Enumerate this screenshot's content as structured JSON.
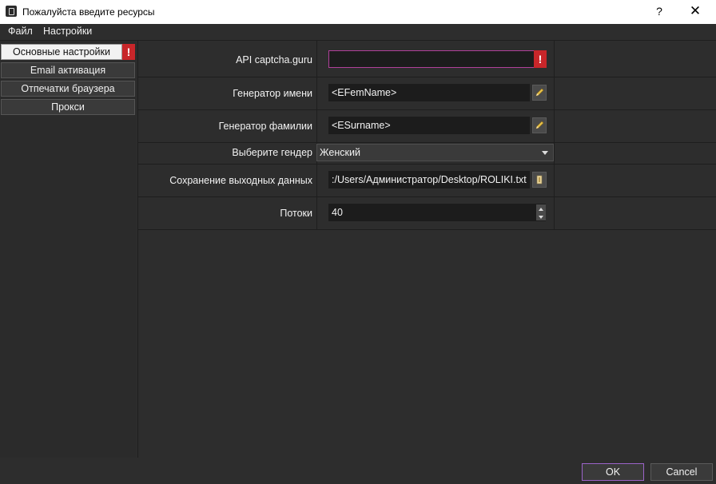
{
  "window": {
    "title": "Пожалуйста введите ресурсы",
    "help_label": "?",
    "close_label": "✕"
  },
  "menu": {
    "items": [
      {
        "label": "Файл"
      },
      {
        "label": "Настройки"
      }
    ]
  },
  "sidebar": {
    "items": [
      {
        "label": "Основные настройки",
        "active": true,
        "warning": "!"
      },
      {
        "label": "Email активация"
      },
      {
        "label": "Отпечатки браузера"
      },
      {
        "label": "Прокси"
      }
    ]
  },
  "form": {
    "api_captcha": {
      "label": "API captcha.guru",
      "value": "",
      "warning": "!"
    },
    "name_generator": {
      "label": "Генератор имени",
      "value": "<EFemName>",
      "icon": "pencil-icon"
    },
    "surname_generator": {
      "label": "Генератор фамилии",
      "value": "<ESurname>",
      "icon": "pencil-icon"
    },
    "gender": {
      "label": "Выберите гендер",
      "value": "Женский"
    },
    "output_save": {
      "label": "Сохранение выходных данных",
      "value": ":/Users/Администратор/Desktop/ROLIKI.txt",
      "icon": "folder-icon"
    },
    "threads": {
      "label": "Потоки",
      "value": "40"
    }
  },
  "footer": {
    "ok_label": "OK",
    "cancel_label": "Cancel"
  },
  "colors": {
    "accent": "#9b63c9",
    "warning": "#c8262a",
    "error_border": "#b0409a"
  }
}
